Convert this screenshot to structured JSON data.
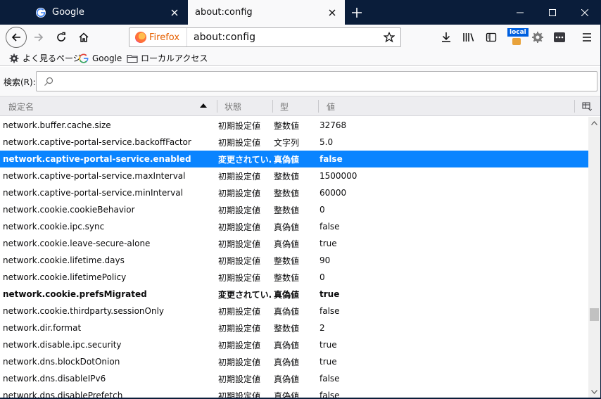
{
  "tabs": [
    {
      "title": "Google",
      "favicon": "G"
    },
    {
      "title": "about:config"
    }
  ],
  "urlbar": {
    "identity_label": "Firefox",
    "url": "about:config"
  },
  "toolbar": {
    "local_badge": "local"
  },
  "bookmarks": [
    {
      "label": "よく見るページ",
      "icon": "gear-icon"
    },
    {
      "label": "Google",
      "icon": "google-icon"
    },
    {
      "label": "ローカルアクセス",
      "icon": "folder-icon"
    }
  ],
  "search": {
    "label": "検索(R):",
    "placeholder": ""
  },
  "columns": {
    "name": "設定名",
    "status": "状態",
    "type": "型",
    "value": "値"
  },
  "rows": [
    {
      "name": "network.buffer.cache.size",
      "status": "初期設定値",
      "type": "整数値",
      "value": "32768",
      "modified": false,
      "selected": false
    },
    {
      "name": "network.captive-portal-service.backoffFactor",
      "status": "初期設定値",
      "type": "文字列",
      "value": "5.0",
      "modified": false,
      "selected": false
    },
    {
      "name": "network.captive-portal-service.enabled",
      "status": "変更されてい...",
      "type": "真偽値",
      "value": "false",
      "modified": true,
      "selected": true
    },
    {
      "name": "network.captive-portal-service.maxInterval",
      "status": "初期設定値",
      "type": "整数値",
      "value": "1500000",
      "modified": false,
      "selected": false
    },
    {
      "name": "network.captive-portal-service.minInterval",
      "status": "初期設定値",
      "type": "整数値",
      "value": "60000",
      "modified": false,
      "selected": false
    },
    {
      "name": "network.cookie.cookieBehavior",
      "status": "初期設定値",
      "type": "整数値",
      "value": "0",
      "modified": false,
      "selected": false
    },
    {
      "name": "network.cookie.ipc.sync",
      "status": "初期設定値",
      "type": "真偽値",
      "value": "false",
      "modified": false,
      "selected": false
    },
    {
      "name": "network.cookie.leave-secure-alone",
      "status": "初期設定値",
      "type": "真偽値",
      "value": "true",
      "modified": false,
      "selected": false
    },
    {
      "name": "network.cookie.lifetime.days",
      "status": "初期設定値",
      "type": "整数値",
      "value": "90",
      "modified": false,
      "selected": false
    },
    {
      "name": "network.cookie.lifetimePolicy",
      "status": "初期設定値",
      "type": "整数値",
      "value": "0",
      "modified": false,
      "selected": false
    },
    {
      "name": "network.cookie.prefsMigrated",
      "status": "変更されてい...",
      "type": "真偽値",
      "value": "true",
      "modified": true,
      "selected": false
    },
    {
      "name": "network.cookie.thirdparty.sessionOnly",
      "status": "初期設定値",
      "type": "真偽値",
      "value": "false",
      "modified": false,
      "selected": false
    },
    {
      "name": "network.dir.format",
      "status": "初期設定値",
      "type": "整数値",
      "value": "2",
      "modified": false,
      "selected": false
    },
    {
      "name": "network.disable.ipc.security",
      "status": "初期設定値",
      "type": "真偽値",
      "value": "true",
      "modified": false,
      "selected": false
    },
    {
      "name": "network.dns.blockDotOnion",
      "status": "初期設定値",
      "type": "真偽値",
      "value": "true",
      "modified": false,
      "selected": false
    },
    {
      "name": "network.dns.disableIPv6",
      "status": "初期設定値",
      "type": "真偽値",
      "value": "false",
      "modified": false,
      "selected": false
    },
    {
      "name": "network.dns.disablePrefetch",
      "status": "初期設定値",
      "type": "真偽値",
      "value": "false",
      "modified": false,
      "selected": false
    }
  ],
  "colors": {
    "titlebar": "#0a1d3a",
    "selection": "#0a84ff",
    "identity": "#e66000"
  }
}
